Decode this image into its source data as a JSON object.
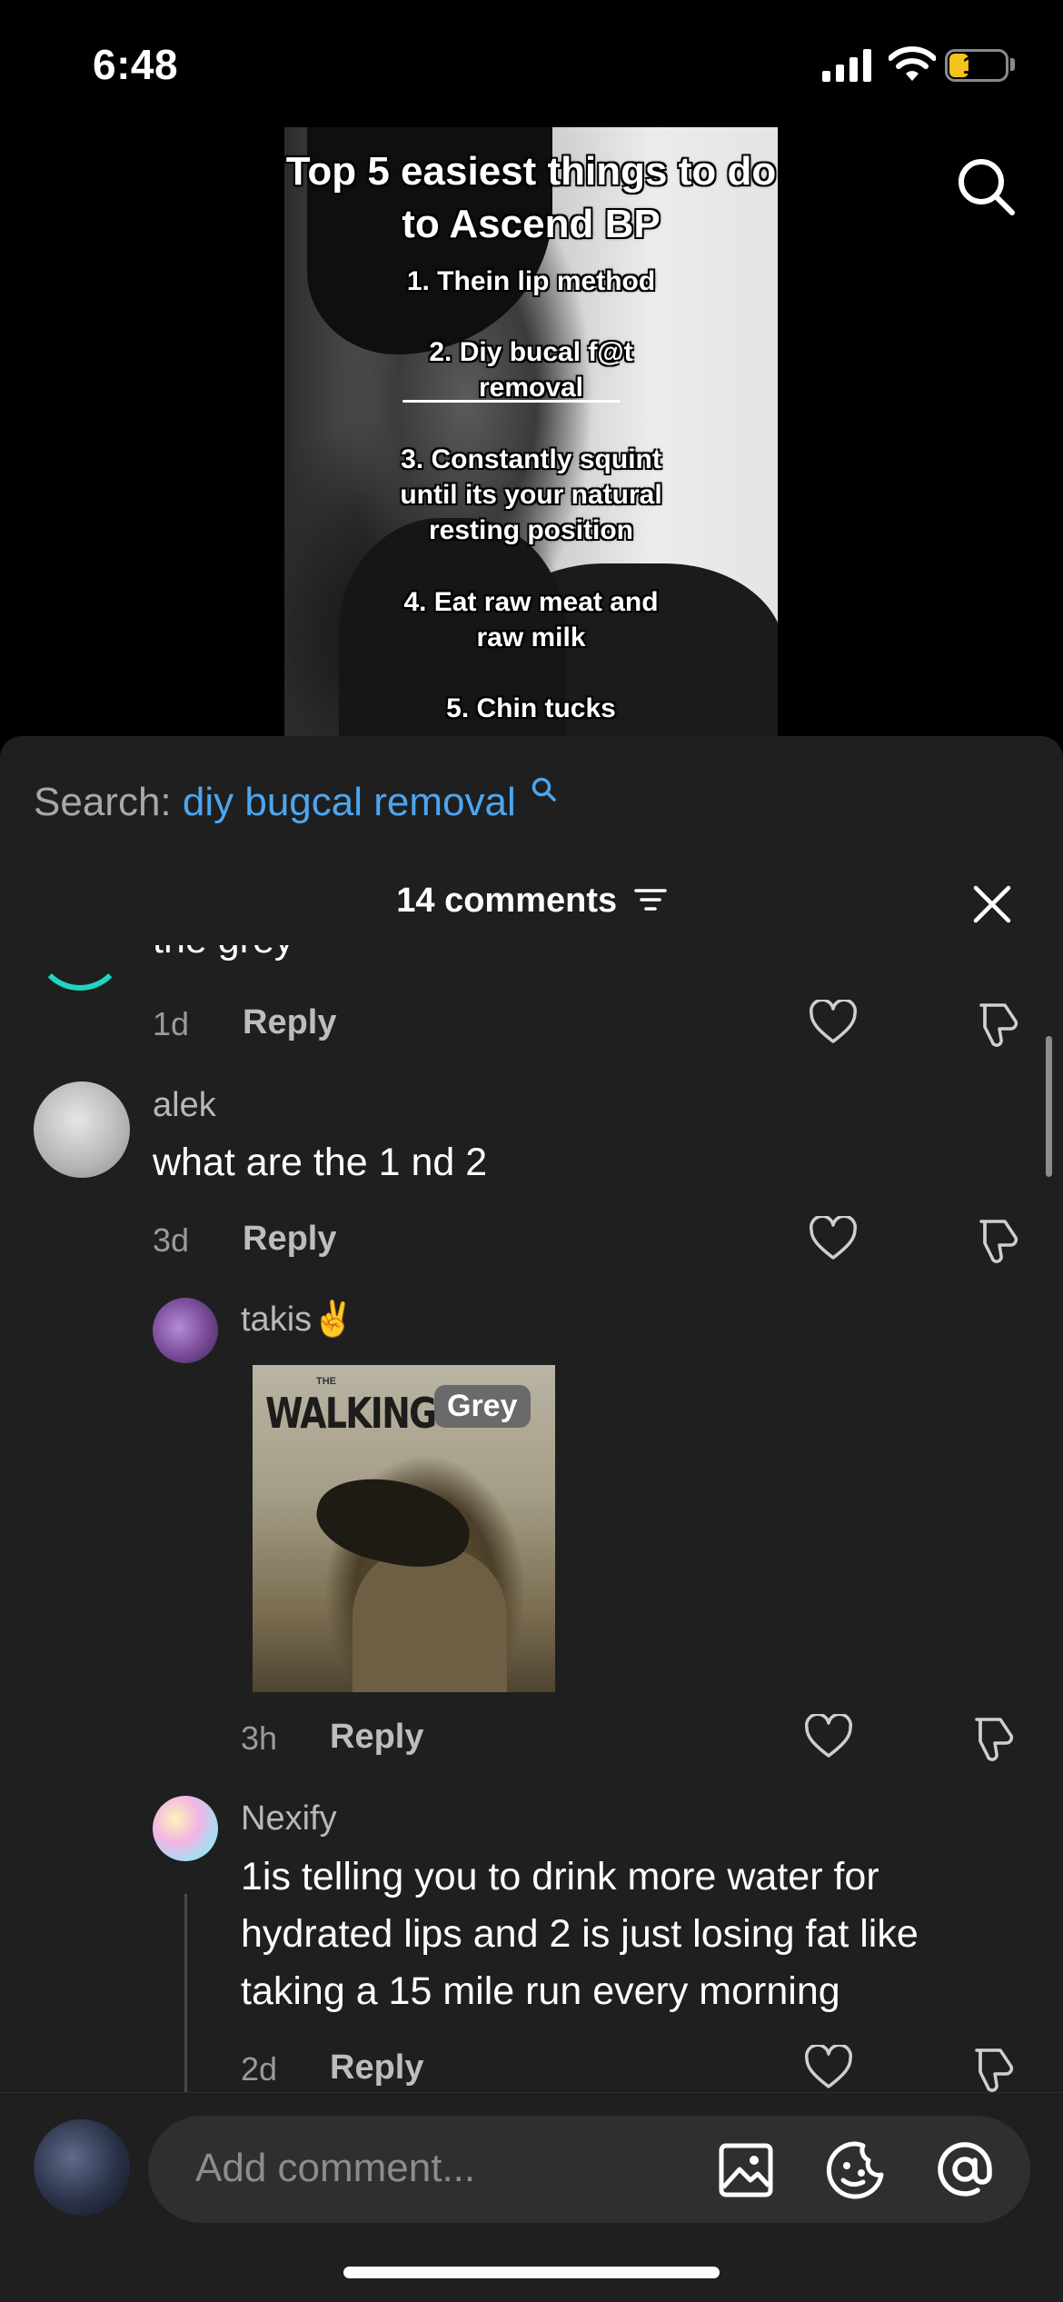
{
  "status_bar": {
    "time": "6:48",
    "battery": "18",
    "battery_level": 0.18
  },
  "video": {
    "title": "Top 5 easiest things to do to Ascend BP",
    "lines": [
      "1. Thein lip method",
      "2. Diy bucal f@t",
      "removal",
      "3. Constantly squint",
      "until its your natural",
      "resting position",
      "4. Eat raw meat and",
      "raw milk",
      "5. Chin tucks"
    ]
  },
  "search": {
    "label": "Search:",
    "query": "diy bugcal removal"
  },
  "comments_panel": {
    "count_label": "14 comments"
  },
  "comments": [
    {
      "text_cut": "the grey",
      "age": "1d",
      "reply": "Reply"
    },
    {
      "user": "alek",
      "text": "what are the 1 nd 2",
      "age": "3d",
      "reply": "Reply"
    },
    {
      "user": "takis✌️",
      "image_title": "WALKING",
      "image_the": "THE",
      "image_badge": "Grey",
      "age": "3h",
      "reply": "Reply"
    },
    {
      "user": "Nexify",
      "lines": [
        "1is telling you to drink more water for",
        "hydrated lips and 2 is just losing fat like",
        "taking a 15 mile run every morning"
      ],
      "age": "2d",
      "reply": "Reply"
    }
  ],
  "composer": {
    "placeholder": "Add comment..."
  },
  "icons": [
    "search-icon",
    "sort-icon",
    "close-icon",
    "heart-icon",
    "dislike-icon",
    "image-icon",
    "emoji-icon",
    "at-icon"
  ],
  "colors": {
    "accent_link": "#4ca6f0",
    "battery": "#f3c21b",
    "sheet_bg": "#1f1f1f"
  }
}
